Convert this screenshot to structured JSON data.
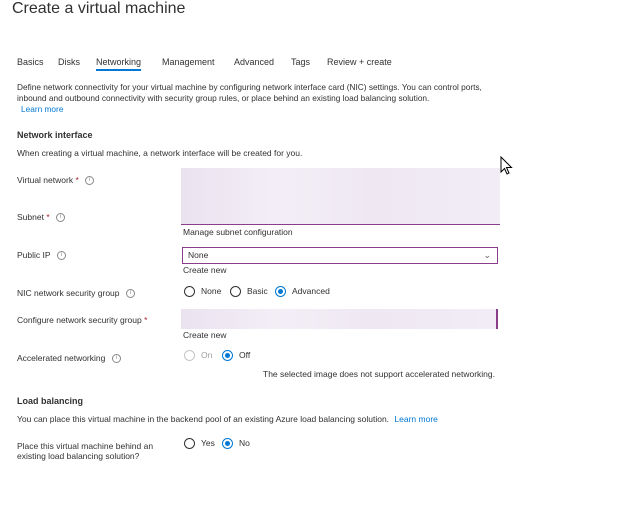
{
  "page": {
    "title": "Create a virtual machine"
  },
  "tabs": [
    {
      "label": "Basics"
    },
    {
      "label": "Disks"
    },
    {
      "label": "Networking"
    },
    {
      "label": "Management"
    },
    {
      "label": "Advanced"
    },
    {
      "label": "Tags"
    },
    {
      "label": "Review + create"
    }
  ],
  "intro": {
    "text": "Define network connectivity for your virtual machine by configuring network interface card (NIC) settings. You can control ports, inbound and outbound connectivity with security group rules, or place behind an existing load balancing solution.",
    "learn_more": "Learn more"
  },
  "network_interface": {
    "heading": "Network interface",
    "subtext": "When creating a virtual machine, a network interface will be created for you.",
    "virtual_network_label": "Virtual network",
    "subnet_label": "Subnet",
    "manage_subnet_link": "Manage subnet configuration",
    "public_ip_label": "Public IP",
    "public_ip_value": "None",
    "public_ip_create_new": "Create new",
    "nic_nsg_label": "NIC network security group",
    "nic_nsg_options": [
      "None",
      "Basic",
      "Advanced"
    ],
    "nic_nsg_selected": "Advanced",
    "configure_nsg_label": "Configure network security group",
    "configure_nsg_create_new": "Create new",
    "accel_label": "Accelerated networking",
    "accel_options": [
      "On",
      "Off"
    ],
    "accel_selected": "Off",
    "accel_note": "The selected image does not support accelerated networking.",
    "required_mark": "*",
    "info_glyph": "i"
  },
  "load_balancing": {
    "heading": "Load balancing",
    "text": "You can place this virtual machine in the backend pool of an existing Azure load balancing solution.",
    "learn_more": "Learn more",
    "question_line1": "Place this virtual machine behind an",
    "question_line2": "existing load balancing solution?",
    "options": [
      "Yes",
      "No"
    ],
    "selected": "No"
  },
  "icons": {
    "chevron": "chevron-down-icon",
    "info": "info-icon",
    "cursor": "mouse-pointer-icon"
  },
  "colors": {
    "accent": "#0078d4",
    "select_border": "#8a3d8a",
    "redacted": "#efe8f3"
  }
}
